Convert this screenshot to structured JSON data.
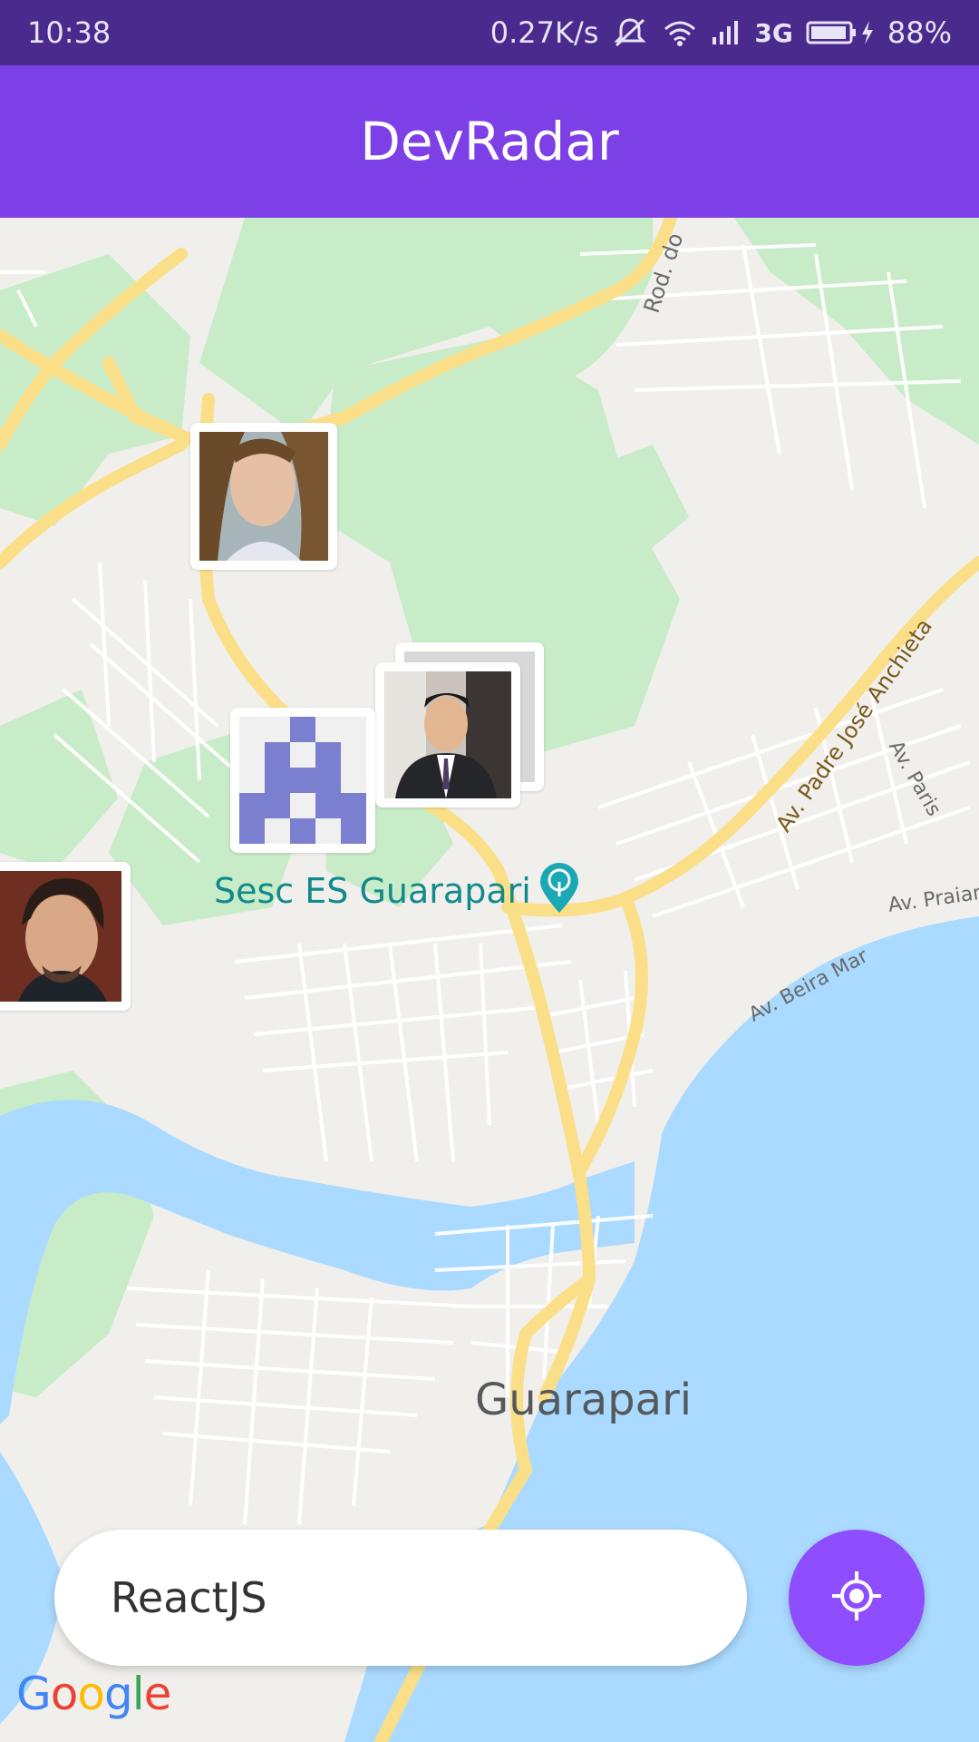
{
  "status_bar": {
    "time": "10:38",
    "speed": "0.27K/s",
    "network": "3G",
    "battery": "88%"
  },
  "app_bar": {
    "title": "DevRadar"
  },
  "map": {
    "poi_label": "Sesc ES Guarapari",
    "city_label": "Guarapari",
    "roads": [
      "Rod. do",
      "Av. Padre José Anchieta",
      "Av. Paris",
      "Av. Praian",
      "Av. Beira Mar"
    ],
    "attribution": "Google"
  },
  "search": {
    "value": "ReactJS"
  },
  "colors": {
    "status_bar": "#4a2a8c",
    "app_bar": "#7d40e7",
    "locate_button": "#8e4dff",
    "water": "#aadaff",
    "park": "#c8ebc8",
    "road_major": "#fbdf88"
  },
  "icons": {
    "locate": "my-location-icon"
  }
}
